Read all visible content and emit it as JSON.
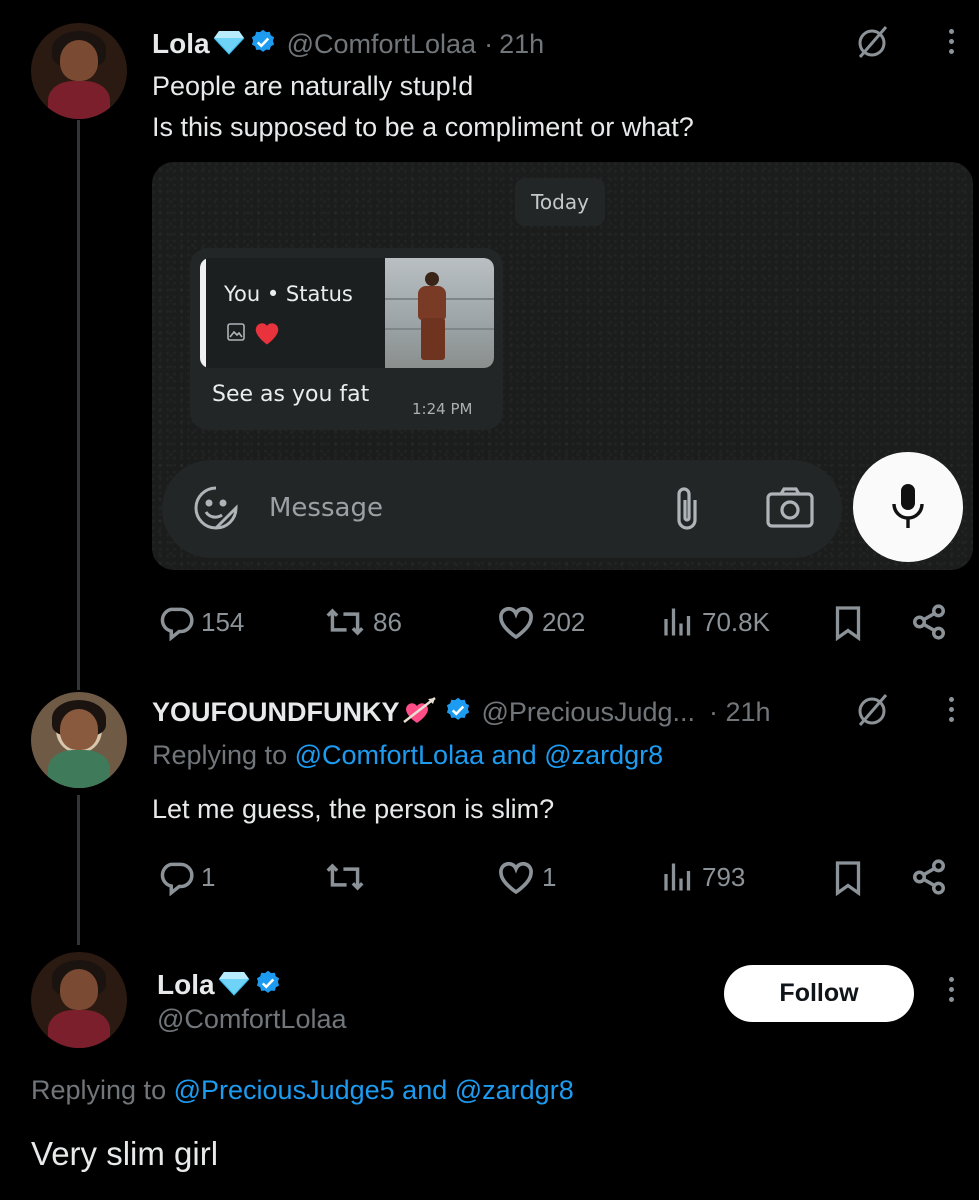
{
  "tweet1": {
    "display_name": "Lola",
    "handle": "@ComfortLolaa",
    "dot": "·",
    "time": "21h",
    "line1": "People are naturally stup!d",
    "line2": "Is this supposed to be a compliment or what?",
    "media": {
      "date_chip": "Today",
      "quote_title": "You • Status",
      "message": "See as you fat",
      "msg_time": "1:24 PM",
      "input_placeholder": "Message"
    },
    "stats": {
      "replies": "154",
      "reposts": "86",
      "likes": "202",
      "views": "70.8K"
    }
  },
  "tweet2": {
    "display_name": "YOUFOUNDFUNKY",
    "handle": "@PreciousJudg...",
    "time": "· 21h",
    "replying_prefix": "Replying to",
    "replying_user1": "@ComfortLolaa",
    "replying_and": "and",
    "replying_user2": "@zardgr8",
    "text": "Let me guess, the person is slim?",
    "stats": {
      "replies": "1",
      "reposts": "",
      "likes": "1",
      "views": "793"
    }
  },
  "tweet3": {
    "display_name": "Lola",
    "handle": "@ComfortLolaa",
    "follow_label": "Follow",
    "replying_prefix": "Replying to",
    "replying_user1": "@PreciousJudge5",
    "replying_and": "and",
    "replying_user2": "@zardgr8",
    "text": "Very slim girl"
  },
  "colors": {
    "accent": "#1d9bf0",
    "muted": "#71767b",
    "text": "#e7e9ea",
    "bg": "#000000"
  }
}
